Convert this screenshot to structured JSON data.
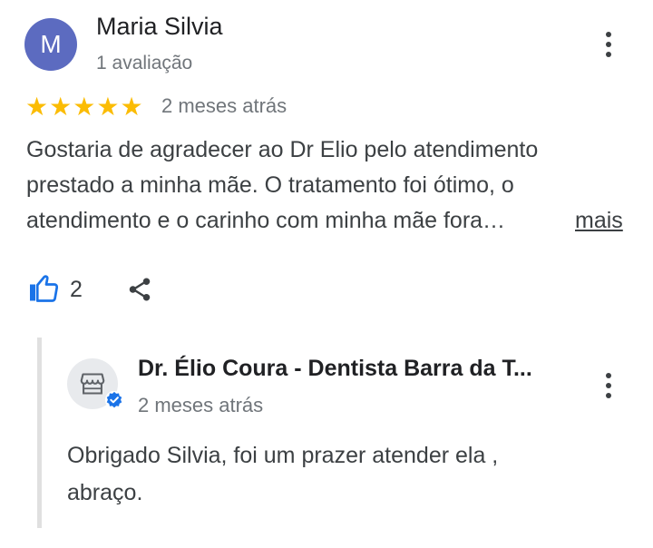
{
  "review": {
    "avatar_letter": "M",
    "avatar_color": "#5c6bc0",
    "author": "Maria Silvia",
    "author_meta": "1 avaliação",
    "rating": 5,
    "date": "2 meses atrás",
    "text_lines": [
      "Gostaria de agradecer ao Dr Elio pelo atendimento",
      "prestado a minha mãe. O tratamento foi ótimo, o",
      "atendimento e o carinho com minha mãe fora…"
    ],
    "more_label": "mais",
    "like_count": "2",
    "star_color": "#fbbc04"
  },
  "reply": {
    "owner_name": "Dr. Élio Coura - Dentista Barra da T...",
    "date": "2 meses atrás",
    "text_lines": [
      "Obrigado Silvia, foi um prazer atender ela ,",
      "abraço."
    ],
    "verified_color": "#1a73e8"
  },
  "icons": {
    "menu": "more-vert-icon",
    "like": "thumb-up-icon",
    "share": "share-icon",
    "store": "storefront-icon",
    "verified": "verified-badge-icon",
    "star": "star-icon"
  }
}
